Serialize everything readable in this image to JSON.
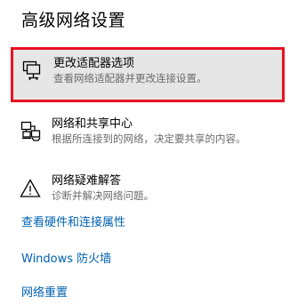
{
  "section": {
    "title": "高级网络设置"
  },
  "options": [
    {
      "title": "更改适配器选项",
      "description": "查看网络适配器并更改连接设置。",
      "icon": "network-adapter-icon",
      "selected": true
    },
    {
      "title": "网络和共享中心",
      "description": "根据所连接到的网络，决定要共享的内容。",
      "icon": "network-sharing-icon",
      "selected": false
    },
    {
      "title": "网络疑难解答",
      "description": "诊断并解决网络问题。",
      "icon": "warning-triangle-icon",
      "selected": false
    }
  ],
  "links": [
    "查看硬件和连接属性",
    "Windows 防火墙",
    "网络重置"
  ],
  "colors": {
    "accent_link": "#0063b1",
    "highlight_border": "#e81123",
    "selected_background": "#e6e6e6"
  }
}
